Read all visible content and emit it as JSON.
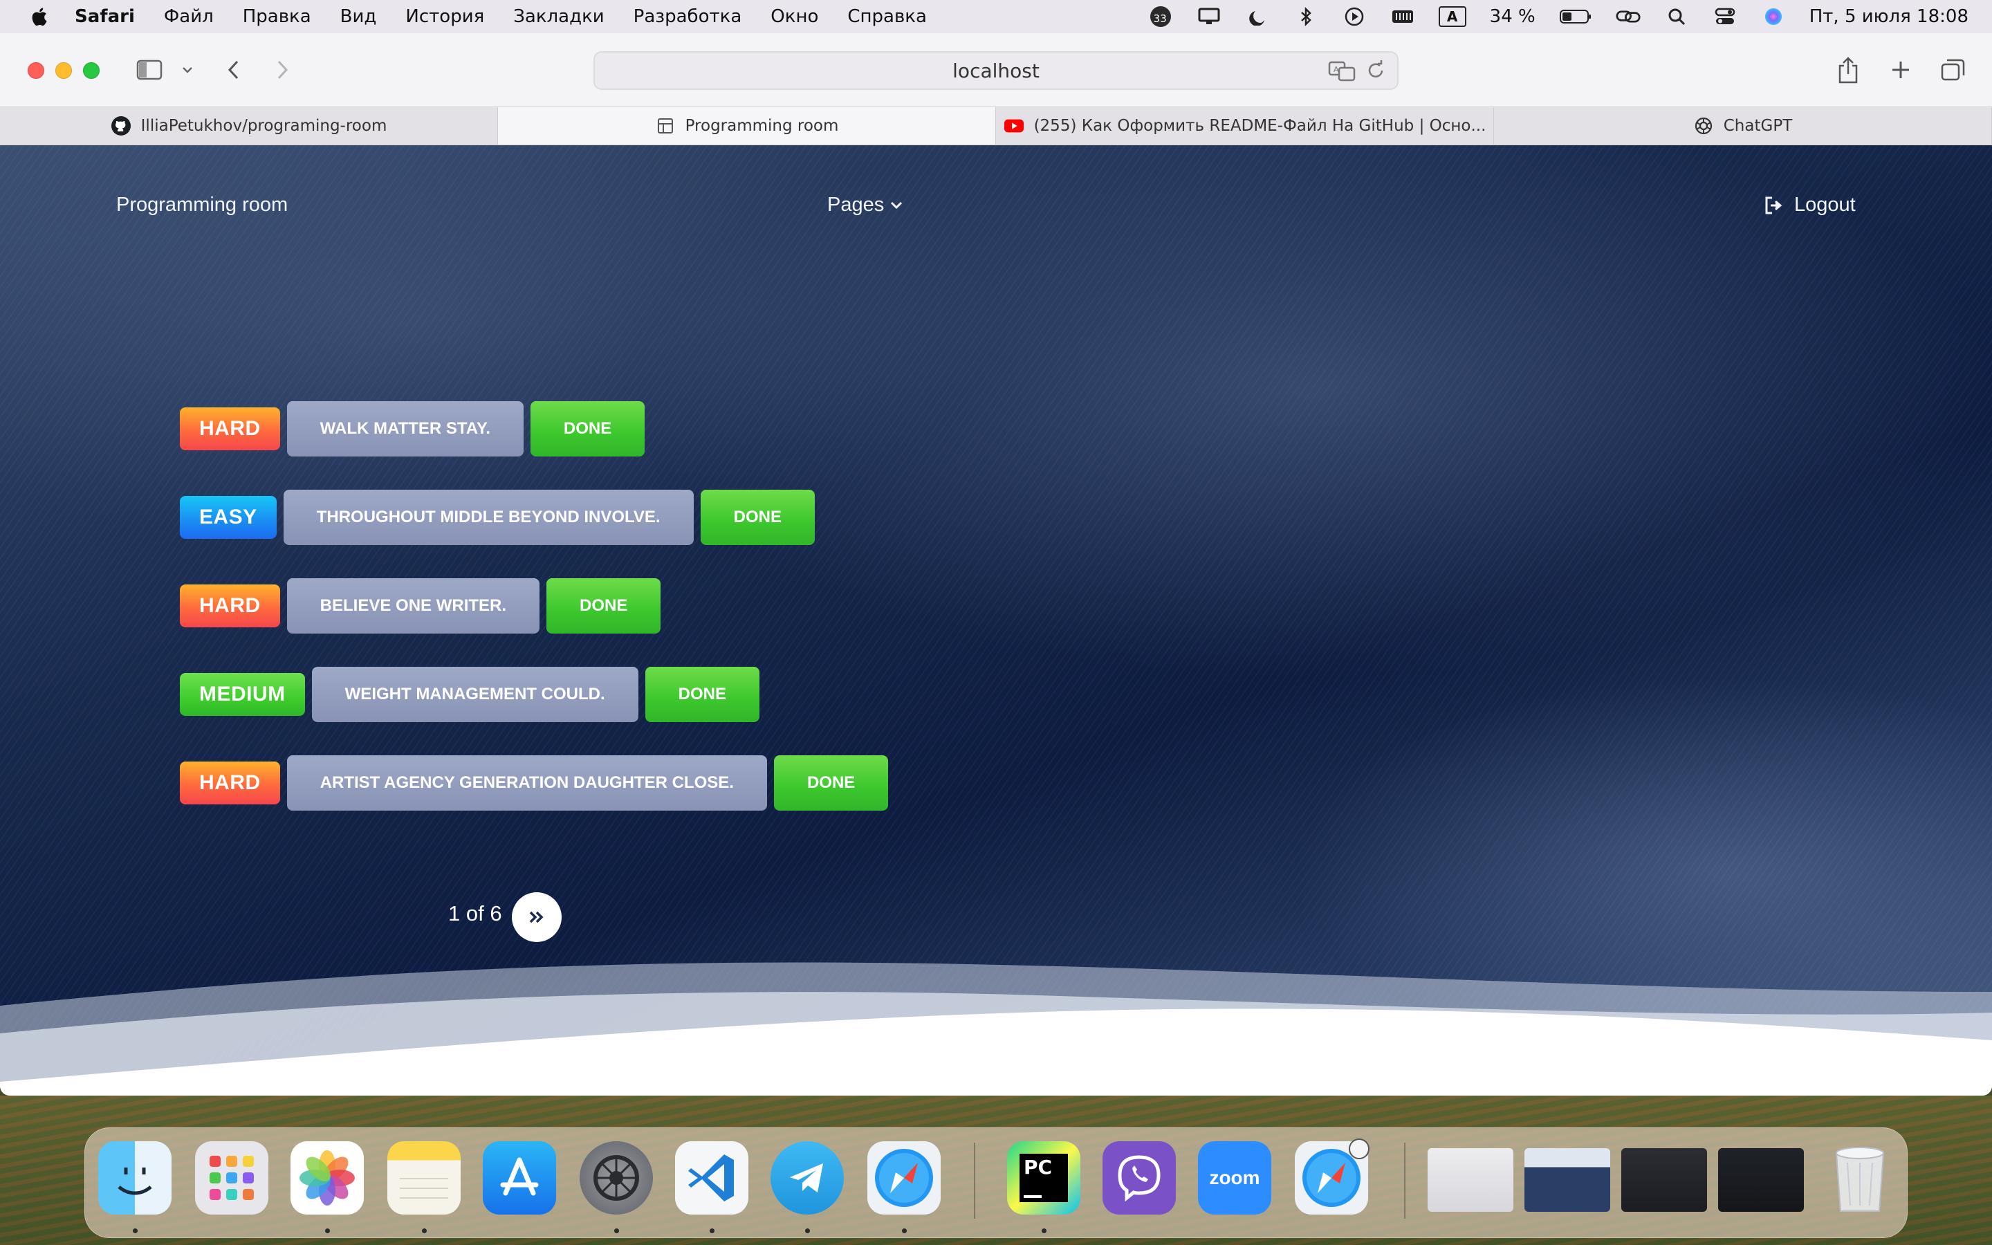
{
  "menubar": {
    "app_name": "Safari",
    "items": [
      "Файл",
      "Правка",
      "Вид",
      "История",
      "Закладки",
      "Разработка",
      "Окно",
      "Справка"
    ],
    "notification_count": "33",
    "battery": "34 %",
    "datetime": "Пт, 5 июля  18:08",
    "input_source": "A"
  },
  "browser": {
    "address": "localhost",
    "tabs": [
      {
        "title": "IlliaPetukhov/programing-room",
        "icon": "github-icon"
      },
      {
        "title": "Programming room",
        "icon": "site-icon",
        "active": true
      },
      {
        "title": "(255) Как Оформить README-Файл На GitHub | Осно...",
        "icon": "youtube-icon"
      },
      {
        "title": "ChatGPT",
        "icon": "chatgpt-icon"
      }
    ]
  },
  "page": {
    "brand": "Programming room",
    "nav_pages": "Pages",
    "logout": "Logout",
    "tasks": [
      {
        "difficulty": "HARD",
        "level": "hard",
        "text": "WALK MATTER STAY.",
        "action": "DONE"
      },
      {
        "difficulty": "EASY",
        "level": "easy",
        "text": "THROUGHOUT MIDDLE BEYOND INVOLVE.",
        "action": "DONE"
      },
      {
        "difficulty": "HARD",
        "level": "hard",
        "text": "BELIEVE ONE WRITER.",
        "action": "DONE"
      },
      {
        "difficulty": "MEDIUM",
        "level": "medium",
        "text": "WEIGHT MANAGEMENT COULD.",
        "action": "DONE"
      },
      {
        "difficulty": "HARD",
        "level": "hard",
        "text": "ARTIST AGENCY GENERATION DAUGHTER CLOSE.",
        "action": "DONE"
      }
    ],
    "pagination": {
      "text": "1 of 6",
      "current": 1,
      "total": 6
    }
  },
  "dock": {
    "apps": [
      "Finder",
      "Launchpad",
      "Photos",
      "Notes",
      "App Store",
      "System Settings",
      "Visual Studio Code",
      "Telegram",
      "Safari",
      "PyCharm",
      "Viber",
      "Zoom",
      "Safari Technology Preview"
    ],
    "zoom_label": "zoom",
    "pycharm_label": "PC"
  },
  "colors": {
    "hard": "#ff6a3d",
    "easy": "#1a8cf3",
    "medium": "#3fcd2c",
    "done": "#3cc72d",
    "task_bg": "#8f9abb"
  }
}
